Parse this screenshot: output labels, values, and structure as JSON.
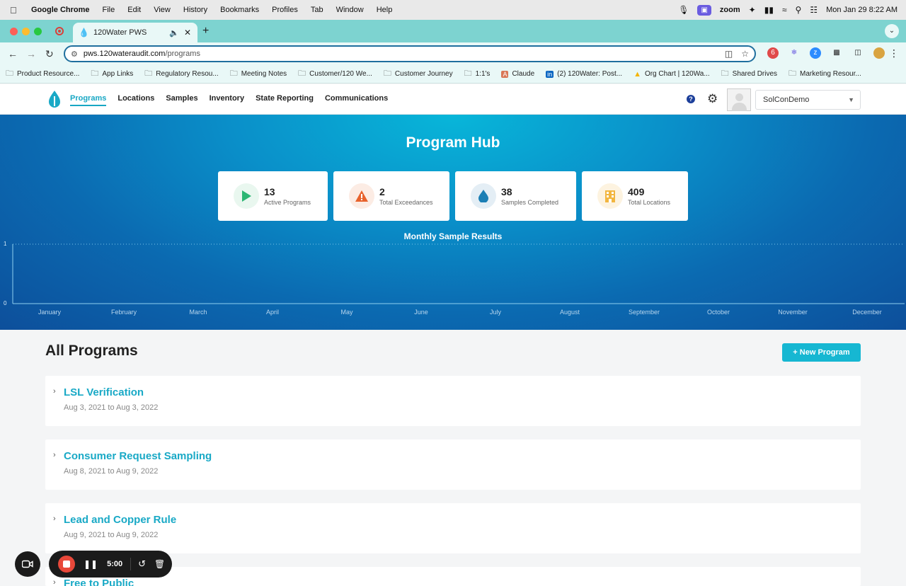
{
  "menubar": {
    "app": "Google Chrome",
    "items": [
      "File",
      "Edit",
      "View",
      "History",
      "Bookmarks",
      "Profiles",
      "Tab",
      "Window",
      "Help"
    ],
    "zoom_label": "zoom",
    "datetime": "Mon Jan 29  8:22 AM"
  },
  "browser": {
    "tab_title": "120Water PWS",
    "url_host": "pws.120wateraudit.com",
    "url_path": "/programs",
    "bookmarks": [
      {
        "label": "Product Resource...",
        "icon": "folder-icon"
      },
      {
        "label": "App Links",
        "icon": "folder-icon"
      },
      {
        "label": "Regulatory Resou...",
        "icon": "folder-icon"
      },
      {
        "label": "Meeting Notes",
        "icon": "folder-icon"
      },
      {
        "label": "Customer/120 We...",
        "icon": "folder-icon"
      },
      {
        "label": "Customer Journey",
        "icon": "folder-icon"
      },
      {
        "label": "1:1's",
        "icon": "folder-icon"
      },
      {
        "label": "Claude",
        "icon": "claude-icon"
      },
      {
        "label": "(2) 120Water: Post...",
        "icon": "linkedin-icon"
      },
      {
        "label": "Org Chart | 120Wa...",
        "icon": "drive-icon"
      },
      {
        "label": "Shared Drives",
        "icon": "folder-icon"
      },
      {
        "label": "Marketing Resour...",
        "icon": "folder-icon"
      }
    ]
  },
  "appnav": {
    "links": [
      "Programs",
      "Locations",
      "Samples",
      "Inventory",
      "State Reporting",
      "Communications"
    ],
    "active": "Programs",
    "org_select": "SolConDemo"
  },
  "hero": {
    "title": "Program Hub",
    "stats": [
      {
        "value": "13",
        "label": "Active Programs",
        "icon": "play-icon",
        "color": "#2bb673"
      },
      {
        "value": "2",
        "label": "Total Exceedances",
        "icon": "warning-icon",
        "color": "#e8622c"
      },
      {
        "value": "38",
        "label": "Samples Completed",
        "icon": "water-drop-icon",
        "color": "#1b7fb5"
      },
      {
        "value": "409",
        "label": "Total Locations",
        "icon": "building-icon",
        "color": "#f2b640"
      }
    ]
  },
  "chart_data": {
    "type": "line",
    "title": "Monthly Sample Results",
    "categories": [
      "January",
      "February",
      "March",
      "April",
      "May",
      "June",
      "July",
      "August",
      "September",
      "October",
      "November",
      "December"
    ],
    "series": [],
    "y_ticks": [
      "0",
      "1"
    ],
    "ylim": [
      0,
      1
    ]
  },
  "programs": {
    "title": "All Programs",
    "new_button": "+ New Program",
    "items": [
      {
        "name": "LSL Verification",
        "dates": "Aug 3, 2021 to Aug 3, 2022"
      },
      {
        "name": "Consumer Request Sampling",
        "dates": "Aug 8, 2021 to Aug 9, 2022"
      },
      {
        "name": "Lead and Copper Rule",
        "dates": "Aug 9, 2021 to Aug 9, 2022"
      },
      {
        "name": "Free to Public",
        "dates": ""
      }
    ]
  },
  "recorder": {
    "time": "5:00"
  }
}
